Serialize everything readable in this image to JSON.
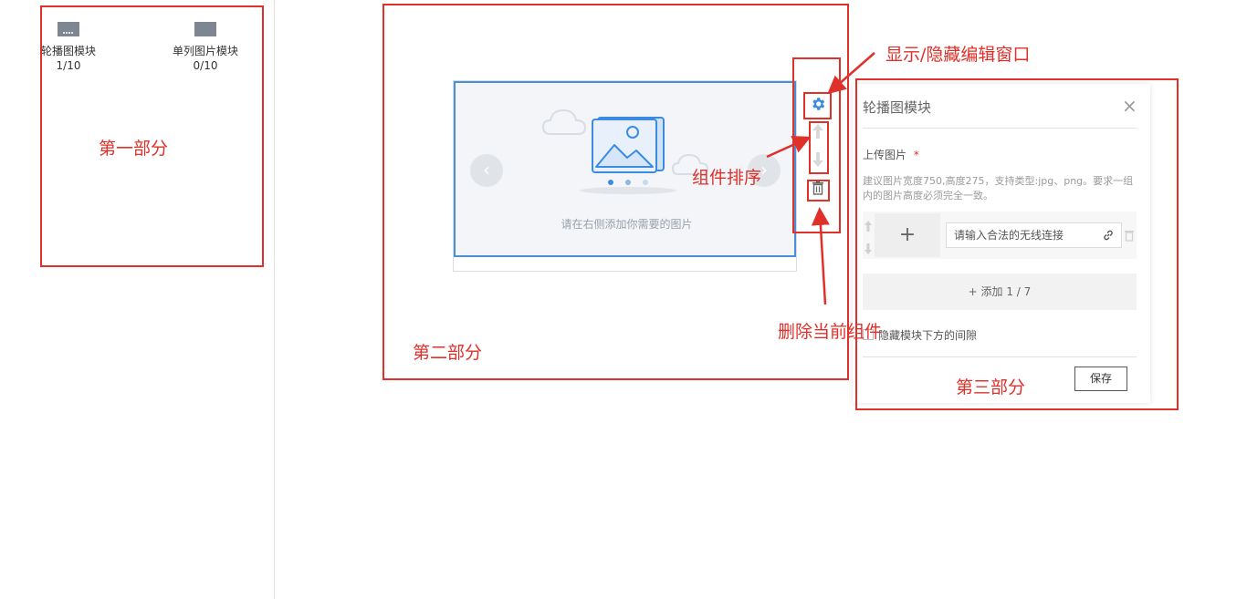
{
  "modules": [
    {
      "name": "轮播图模块",
      "count": "1/10"
    },
    {
      "name": "单列图片模块",
      "count": "0/10"
    }
  ],
  "annotations": {
    "part1": "第一部分",
    "part2": "第二部分",
    "part3": "第三部分",
    "toggle_editor": "显示/隐藏编辑窗口",
    "sort": "组件排序",
    "delete": "删除当前组件"
  },
  "preview": {
    "placeholder": "请在右侧添加你需要的图片",
    "prev": "‹",
    "next": "›"
  },
  "toolbar": {
    "settings_icon": "gear-icon",
    "up_icon": "arrow-up-icon",
    "down_icon": "arrow-down-icon",
    "delete_icon": "trash-icon"
  },
  "editor": {
    "title": "轮播图模块",
    "close": "×",
    "upload_label": "上传图片",
    "required_mark": "*",
    "hint": "建议图片宽度750,高度275，支持类型:jpg、png。要求一组内的图片高度必须完全一致。",
    "add_image": "+",
    "link_placeholder": "请输入合法的无线连接",
    "add_button": "+ 添加 1 / 7",
    "hide_gap_label": "隐藏模块下方的间隙",
    "save": "保存"
  },
  "colors": {
    "annotation_red": "#e0302a",
    "accent_blue": "#3d8be0"
  }
}
